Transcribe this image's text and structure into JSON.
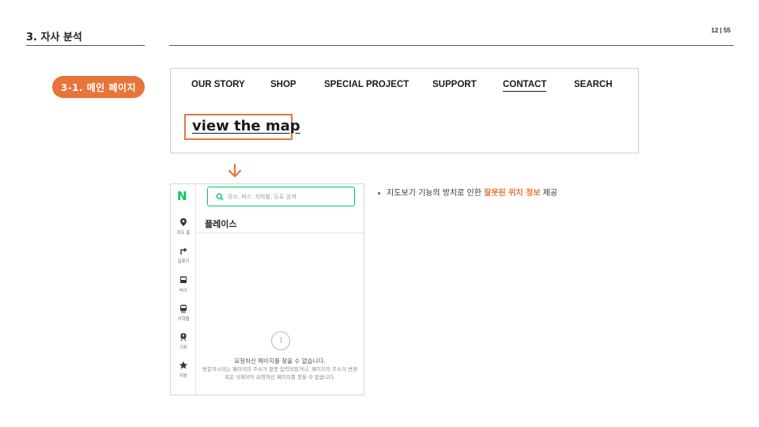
{
  "header": {
    "section_title": "3. 자사 분석",
    "page_number": "12 | 55"
  },
  "sub_section": {
    "label": "3-1. 메인 페이지"
  },
  "site_screenshot": {
    "nav": [
      "OUR STORY",
      "SHOP",
      "SPECIAL PROJECT",
      "SUPPORT",
      "CONTACT",
      "SEARCH"
    ],
    "active_nav": "CONTACT",
    "map_link": "view the map",
    "highlight_color": "#e8743b"
  },
  "naver_map": {
    "logo": "N",
    "search_placeholder": "장소, 버스, 지하철, 도로 검색",
    "rail": [
      {
        "label": "지도 홈",
        "icon": "map-pin-icon"
      },
      {
        "label": "길찾기",
        "icon": "directions-icon"
      },
      {
        "label": "버스",
        "icon": "bus-icon"
      },
      {
        "label": "지하철",
        "icon": "subway-icon"
      },
      {
        "label": "기차",
        "icon": "train-icon"
      },
      {
        "label": "저장",
        "icon": "star-icon"
      }
    ],
    "panel_title": "플레이스",
    "error_title": "요청하신 페이지를 찾을 수 없습니다.",
    "error_detail": "방문하시려는 페이지의 주소가 잘못 입력되었거나, 페이지의 주소가 변경 혹은 삭제되어 요청하신 페이지를 찾을 수 없습니다.",
    "brand_color": "#03c75a"
  },
  "note": {
    "prefix": "지도보기 기능의 방치로 인한 ",
    "highlight": "잘못된 위치 정보",
    "suffix": " 제공"
  }
}
